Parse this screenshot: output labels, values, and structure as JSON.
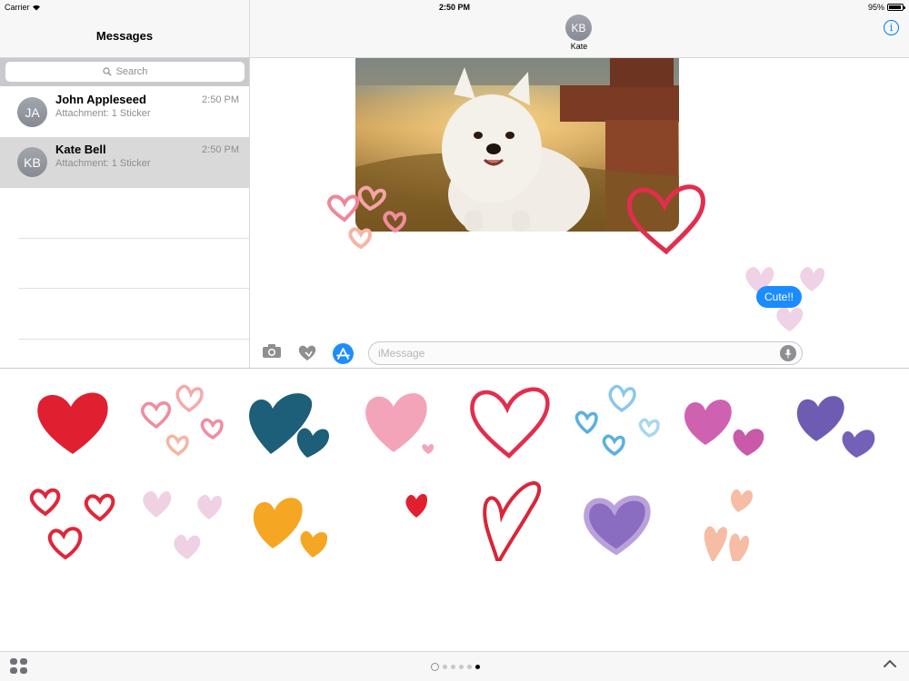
{
  "status_bar": {
    "carrier": "Carrier",
    "time": "2:50 PM",
    "battery": "95%",
    "battery_level": 0.95
  },
  "sidebar": {
    "title": "Messages",
    "search_placeholder": "Search",
    "conversations": [
      {
        "initials": "JA",
        "name": "John Appleseed",
        "time": "2:50 PM",
        "preview": "Attachment: 1 Sticker",
        "selected": false
      },
      {
        "initials": "KB",
        "name": "Kate Bell",
        "time": "2:50 PM",
        "preview": "Attachment: 1 Sticker",
        "selected": true
      }
    ]
  },
  "conversation": {
    "contact_initials": "KB",
    "contact_name": "Kate",
    "info_icon": "info-icon",
    "messages": [
      {
        "type": "photo",
        "description_icon": "dog-photo"
      },
      {
        "type": "text",
        "text": "Cute!!",
        "from_me": true
      }
    ],
    "input_placeholder": "iMessage"
  },
  "sticker_drawer": {
    "stickers": [
      "red-heart",
      "pink-outline-hearts",
      "teal-hearts",
      "pink-heart",
      "red-outline-heart",
      "blue-outline-hearts",
      "magenta-hearts",
      "purple-hearts",
      "red-outline-hearts",
      "light-pink-hearts",
      "orange-hearts",
      "small-red-heart",
      "red-scribble-heart",
      "violet-heart",
      "peach-hearts"
    ],
    "page_count": 5,
    "active_page": 5
  },
  "colors": {
    "accent": "#007aff",
    "bubble": "#1a8cff"
  }
}
